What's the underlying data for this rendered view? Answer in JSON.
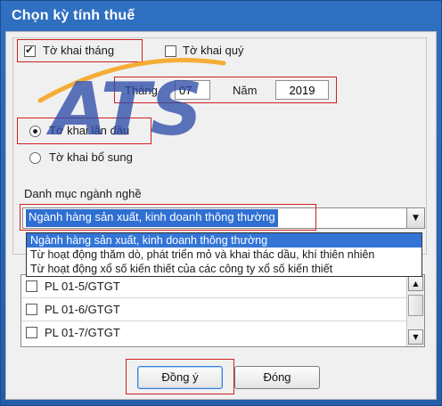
{
  "window": {
    "title": "Chọn kỳ tính thuế"
  },
  "period": {
    "monthly_label": "Tờ khai tháng",
    "monthly_checked": true,
    "quarterly_label": "Tờ khai quý",
    "quarterly_checked": false,
    "month_label": "Tháng",
    "month_value": "07",
    "year_label": "Năm",
    "year_value": "2019"
  },
  "declaration_type": {
    "first_label": "Tờ khai lần đầu",
    "first_selected": true,
    "supplement_label": "Tờ khai bổ sung",
    "supplement_selected": false
  },
  "industry": {
    "label": "Danh mục ngành nghề",
    "selected": "Ngành hàng sản xuất, kinh doanh thông thường",
    "options": [
      "Ngành hàng sản xuất, kinh doanh thông thường",
      "Từ hoạt động thăm dò, phát triển mỏ và khai thác dầu, khí thiên nhiên",
      "Từ hoạt động xổ số kiến thiết của các công ty xổ số kiến thiết"
    ]
  },
  "appendix_list": {
    "items": [
      {
        "label": "PL 01-5/GTGT",
        "checked": false
      },
      {
        "label": "PL 01-6/GTGT",
        "checked": false
      },
      {
        "label": "PL 01-7/GTGT",
        "checked": false
      }
    ]
  },
  "buttons": {
    "ok": "Đồng ý",
    "close": "Đóng"
  },
  "watermark": {
    "text": "ATS"
  },
  "colors": {
    "titlebar": "#2f70c2",
    "highlight": "#3375d6",
    "annotation": "#d02020",
    "logo_blue": "#2b4aa8",
    "logo_orange": "#f5a623"
  }
}
